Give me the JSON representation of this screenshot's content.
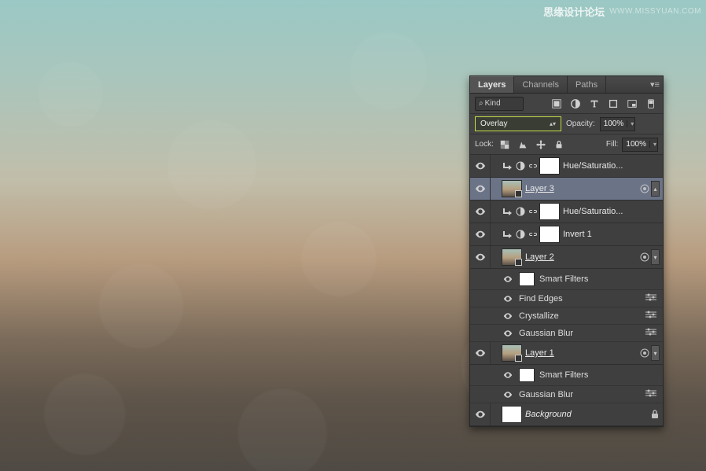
{
  "watermark": {
    "title": "思缘设计论坛",
    "url": "WWW.MISSYUAN.COM"
  },
  "tabs": {
    "layers": "Layers",
    "channels": "Channels",
    "paths": "Paths"
  },
  "filter": {
    "kind": "Kind"
  },
  "blend": {
    "mode": "Overlay",
    "opacity_label": "Opacity:",
    "opacity": "100%",
    "lock_label": "Lock:",
    "fill_label": "Fill:",
    "fill": "100%"
  },
  "layers": [
    {
      "name": "Hue/Saturatio..."
    },
    {
      "name": "Layer 3"
    },
    {
      "name": "Hue/Saturatio..."
    },
    {
      "name": "Invert 1"
    },
    {
      "name": "Layer 2",
      "smart_filters_label": "Smart Filters",
      "filters": [
        "Find Edges",
        "Crystallize",
        "Gaussian Blur"
      ]
    },
    {
      "name": "Layer 1",
      "smart_filters_label": "Smart Filters",
      "filters": [
        "Gaussian Blur"
      ]
    },
    {
      "name": "Background"
    }
  ]
}
